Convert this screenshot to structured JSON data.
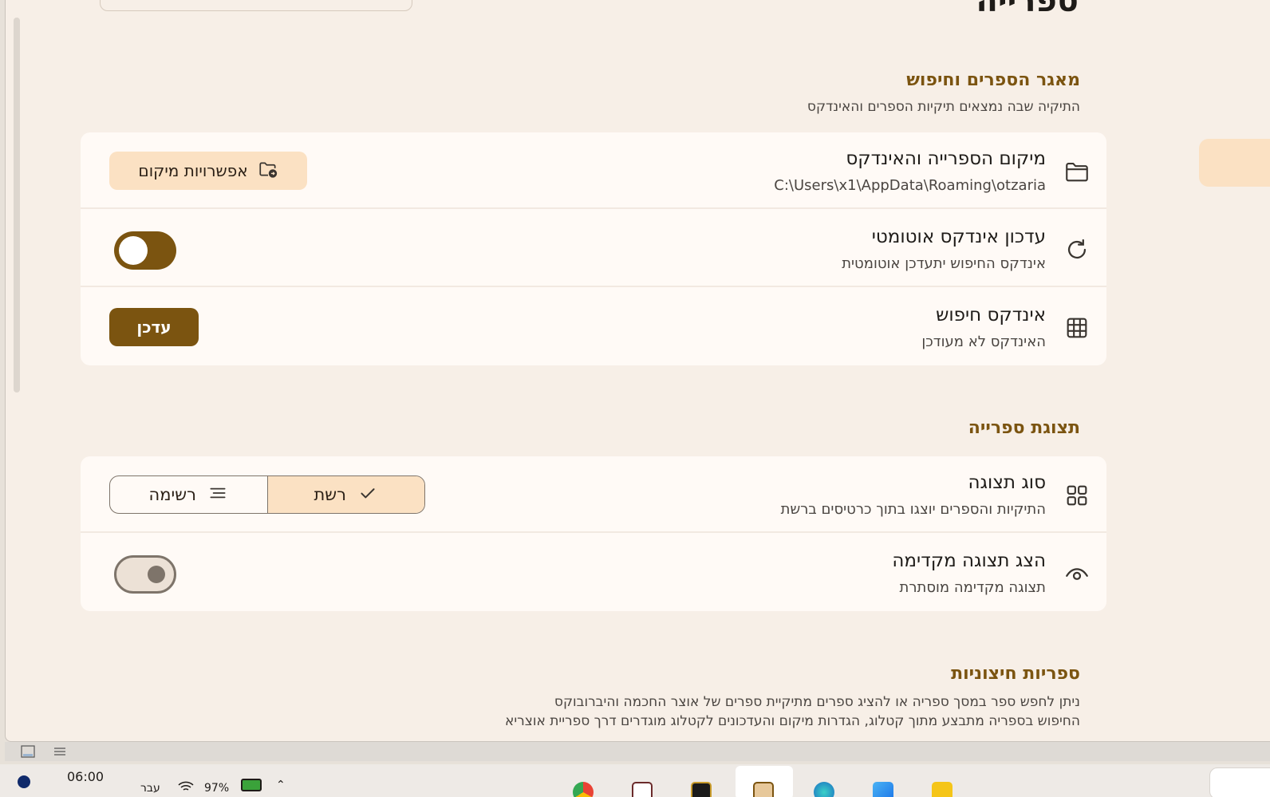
{
  "page": {
    "title": "ספרייה"
  },
  "sections": {
    "library": {
      "title": "מאגר הספרים וחיפוש",
      "subtitle": "התיקיה שבה נמצאים תיקיות הספרים והאינדקס",
      "location_row": {
        "title": "מיקום הספרייה והאינדקס",
        "path": "C:\\Users\\x1\\AppData\\Roaming\\otzaria",
        "button_label": "אפשרויות מיקום",
        "icon": "folder-icon"
      },
      "auto_index_row": {
        "title": "עדכון אינדקס אוטומטי",
        "subtitle": "אינדקס החיפוש יתעדכן אוטומטית",
        "toggle_on": true,
        "icon": "refresh-icon"
      },
      "search_index_row": {
        "title": "אינדקס חיפוש",
        "subtitle": "האינדקס לא מעודכן",
        "button_label": "עדכן",
        "icon": "grid-table-icon"
      }
    },
    "display": {
      "title": "תצוגת ספרייה",
      "view_type_row": {
        "title": "סוג תצוגה",
        "subtitle": "התיקיות והספרים יוצגו בתוך כרטיסים ברשת",
        "options": [
          "רשת",
          "רשימה"
        ],
        "selected": "רשת",
        "icon": "grid-view-icon"
      },
      "preview_row": {
        "title": "הצג תצוגה מקדימה",
        "subtitle": "תצוגה מקדימה מוסתרת",
        "toggle_on": false,
        "icon": "eye-icon"
      }
    },
    "external": {
      "title": "ספריות חיצוניות",
      "line1": "ניתן לחפש ספר במסך ספריה או להציג ספרים מתיקיית ספרים של אוצר החכמה והיברובוקס",
      "line2": "החיפוש בספריה מתבצע מתוך קטלוג, הגדרות מיקום והעדכונים לקטלוג מוגדרים דרך ספריית אוצריא"
    }
  },
  "taskbar": {
    "time": "06:00",
    "language": "עבר",
    "battery": "97%"
  },
  "colors": {
    "accent": "#7b5410",
    "tonal": "#fbe1c3",
    "background": "#f7efe7",
    "card": "#fffaf6"
  }
}
